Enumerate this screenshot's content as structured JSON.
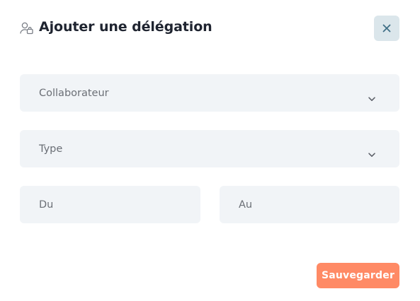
{
  "dialog": {
    "title": "Ajouter une délégation",
    "title_icon": "user-delegate-icon",
    "close_icon": "close-icon"
  },
  "form": {
    "collaborator": {
      "placeholder": "Collaborateur",
      "icon": "chevron-down-icon"
    },
    "type": {
      "placeholder": "Type",
      "icon": "chevron-down-icon"
    },
    "from": {
      "placeholder": "Du"
    },
    "to": {
      "placeholder": "Au"
    }
  },
  "actions": {
    "save_label": "Sauvegarder"
  },
  "colors": {
    "accent": "#ff8a65",
    "field_bg": "#f1f4f7",
    "close_bg": "#dbe6eb",
    "close_icon": "#3f6f86",
    "title": "#1f2430",
    "placeholder": "#6b6f76"
  }
}
